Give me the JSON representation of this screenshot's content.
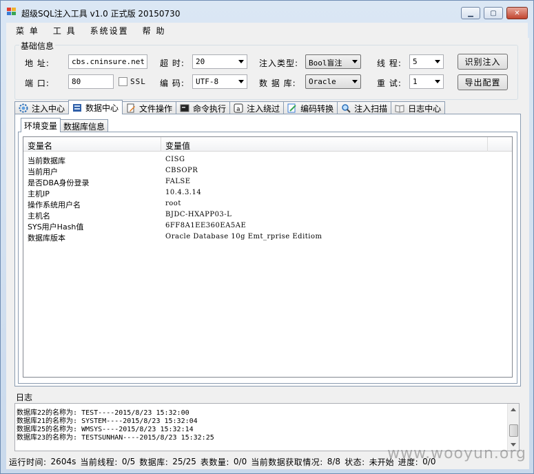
{
  "window": {
    "title": "超级SQL注入工具 v1.0 正式版 20150730",
    "controls": {
      "minimize": "▁",
      "maximize": "▢",
      "close": "✕"
    }
  },
  "menu": [
    "菜 单",
    "工 具",
    "系统设置",
    "帮 助"
  ],
  "basic_info": {
    "legend": "基础信息",
    "address_label": "地 址:",
    "address_value": "cbs.cninsure.net",
    "port_label": "端 口:",
    "port_value": "80",
    "ssl_label": "SSL",
    "timeout_label": "超 时:",
    "timeout_value": "20",
    "encoding_label": "编 码:",
    "encoding_value": "UTF-8",
    "inject_type_label": "注入类型:",
    "inject_type_value": "Bool盲注",
    "database_label": "数 据 库:",
    "database_value": "Oracle",
    "threads_label": "线 程:",
    "threads_value": "5",
    "retry_label": "重 试:",
    "retry_value": "1",
    "identify_button": "识别注入",
    "export_button": "导出配置"
  },
  "tabs": [
    {
      "label": "注入中心",
      "icon": "gear-icon"
    },
    {
      "label": "数据中心",
      "icon": "database-icon",
      "active": true
    },
    {
      "label": "文件操作",
      "icon": "file-edit-icon"
    },
    {
      "label": "命令执行",
      "icon": "terminal-icon"
    },
    {
      "label": "注入绕过",
      "icon": "bypass-icon"
    },
    {
      "label": "编码转换",
      "icon": "encode-icon"
    },
    {
      "label": "注入扫描",
      "icon": "scan-icon"
    },
    {
      "label": "日志中心",
      "icon": "book-icon"
    }
  ],
  "subtabs": [
    {
      "label": "环境变量",
      "active": true
    },
    {
      "label": "数据库信息"
    }
  ],
  "table": {
    "headers": [
      "变量名",
      "变量值"
    ],
    "rows": [
      [
        "当前数据库",
        "CISG"
      ],
      [
        "当前用户",
        "CBSOPR"
      ],
      [
        "是否DBA身份登录",
        "FALSE"
      ],
      [
        "主机IP",
        "10.4.3.14"
      ],
      [
        "操作系统用户名",
        "root"
      ],
      [
        "主机名",
        "BJDC-HXAPP03-L"
      ],
      [
        "SYS用户Hash值",
        "6FF8A1EE360EA5AE"
      ],
      [
        "数据库版本",
        "Oracle Database 10g Emt_rprise Editiom"
      ]
    ]
  },
  "log": {
    "label": "日志",
    "lines": [
      "数据库22的名称为: TEST----2015/8/23 15:32:00",
      "数据库21的名称为: SYSTEM----2015/8/23 15:32:04",
      "数据库25的名称为: WMSYS----2015/8/23 15:32:14",
      "数据库23的名称为: TESTSUNHAN----2015/8/23 15:32:25"
    ]
  },
  "status": {
    "runtime_label": "运行时间:",
    "runtime_value": "2604s",
    "threads_label": "当前线程:",
    "threads_value": "0/5",
    "databases_label": "数据库:",
    "databases_value": "25/25",
    "tables_label": "表数量:",
    "tables_value": "0/0",
    "fetch_label": "当前数据获取情况:",
    "fetch_value": "8/8",
    "state_label": "状态:",
    "state_value": "未开始",
    "progress_label": "进度:",
    "progress_value": "0/0"
  },
  "watermark": "www.wooyun.org",
  "colors": {
    "window_frame": "#dbe7f4",
    "close_button": "#c1452f",
    "panel": "#f0f0f0"
  }
}
